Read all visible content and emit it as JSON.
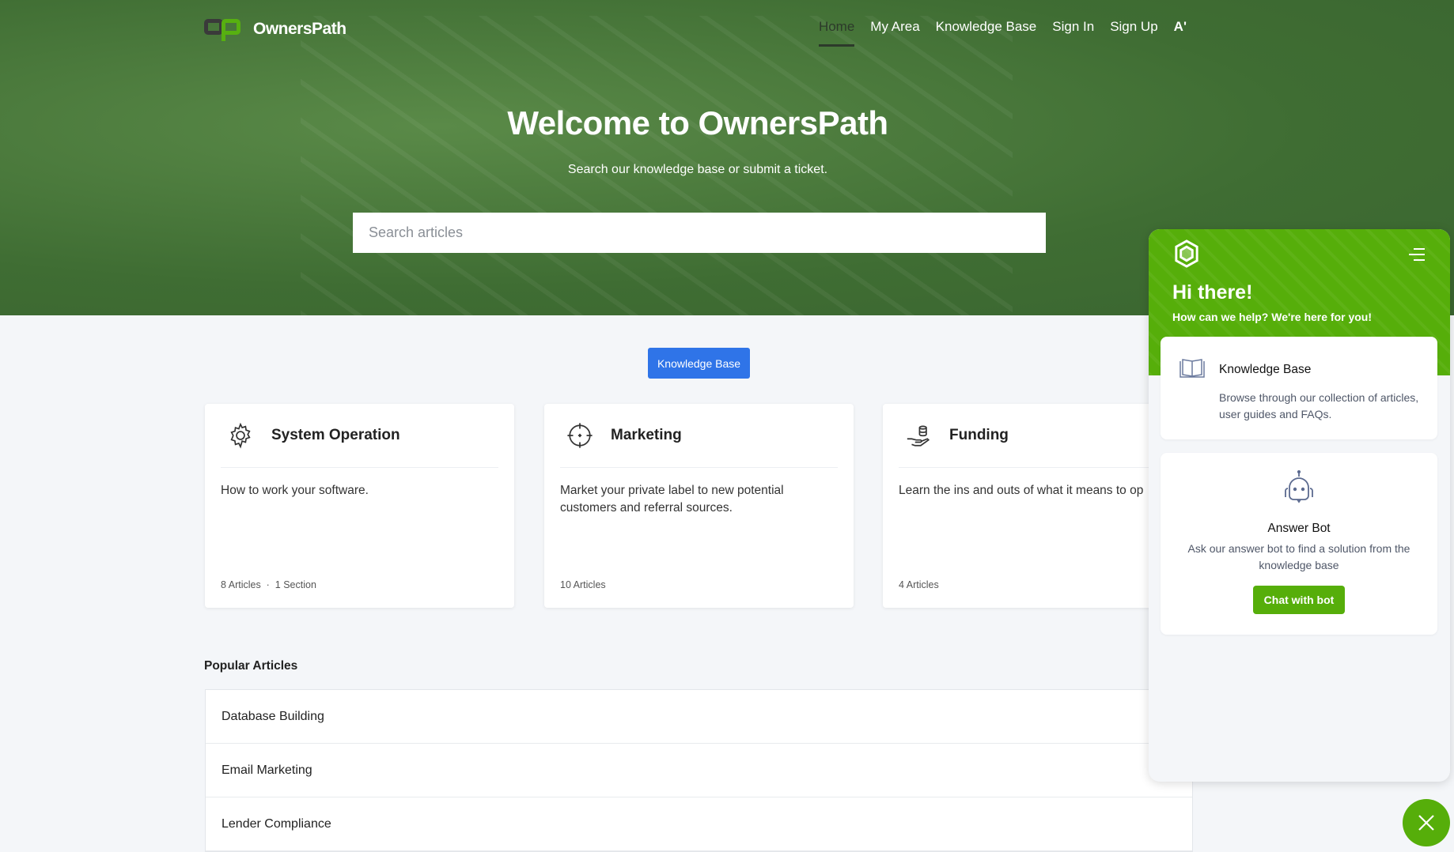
{
  "brand": {
    "name": "OwnersPath"
  },
  "nav": {
    "items": [
      {
        "label": "Home",
        "active": true
      },
      {
        "label": "My Area"
      },
      {
        "label": "Knowledge Base"
      },
      {
        "label": "Sign In"
      },
      {
        "label": "Sign Up"
      },
      {
        "label": "A'"
      }
    ]
  },
  "hero": {
    "title": "Welcome to OwnersPath",
    "subtitle": "Search our knowledge base or submit a ticket.",
    "search_placeholder": "Search articles"
  },
  "kb_button": "Knowledge Base",
  "categories": [
    {
      "icon": "gear-icon",
      "title": "System Operation",
      "desc": "How to work your software.",
      "articles": "8 Articles",
      "sections": "1 Section"
    },
    {
      "icon": "crosshair-icon",
      "title": "Marketing",
      "desc": "Market your private label to new potential customers and referral sources.",
      "articles": "10 Articles"
    },
    {
      "icon": "coins-hand-icon",
      "title": "Funding",
      "desc": "Learn the ins and outs of what it means to op",
      "articles": "4 Articles"
    }
  ],
  "popular": {
    "title": "Popular Articles",
    "items": [
      "Database Building",
      "Email Marketing",
      "Lender Compliance"
    ]
  },
  "chat": {
    "greeting": "Hi there!",
    "tagline": "How can we help? We're here for you!",
    "kb": {
      "title": "Knowledge Base",
      "desc": "Browse through our collection of articles, user guides and FAQs."
    },
    "bot": {
      "title": "Answer Bot",
      "desc": "Ask our answer bot to find a solution from the knowledge base",
      "button": "Chat with bot"
    }
  },
  "colors": {
    "accent_green": "#56ae0a",
    "primary_blue": "#2f74e8"
  }
}
